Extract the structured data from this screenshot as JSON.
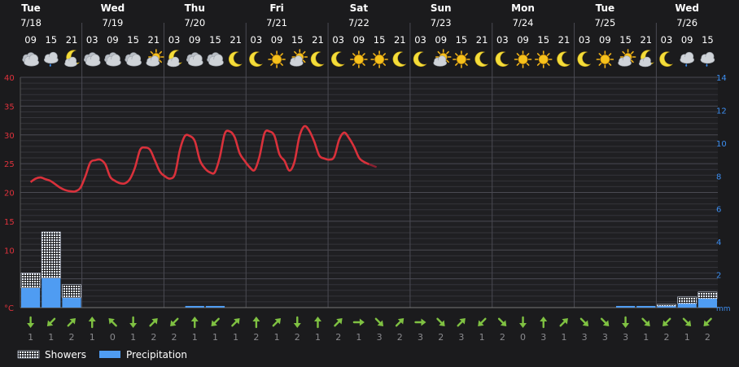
{
  "chart_data": {
    "type": "line",
    "days": [
      {
        "label": "Tue",
        "date": "7/18"
      },
      {
        "label": "Wed",
        "date": "7/19"
      },
      {
        "label": "Thu",
        "date": "7/20"
      },
      {
        "label": "Fri",
        "date": "7/21"
      },
      {
        "label": "Sat",
        "date": "7/22"
      },
      {
        "label": "Sun",
        "date": "7/23"
      },
      {
        "label": "Mon",
        "date": "7/24"
      },
      {
        "label": "Tue",
        "date": "7/25"
      },
      {
        "label": "Wed",
        "date": "7/26"
      }
    ],
    "hours": [
      "09",
      "15",
      "21",
      "03",
      "09",
      "15",
      "21",
      "03",
      "09",
      "15",
      "21",
      "03",
      "09",
      "15",
      "21",
      "03",
      "09",
      "15",
      "21",
      "03",
      "09",
      "15",
      "21",
      "03",
      "09",
      "15",
      "21",
      "03",
      "09",
      "15",
      "21",
      "03",
      "09",
      "15"
    ],
    "weather_icons": [
      "cloudy-icon",
      "rain-cloud-icon",
      "partly-cloudy-night-icon",
      "cloudy-icon",
      "cloudy-icon",
      "cloudy-icon",
      "partly-cloudy-day-icon",
      "partly-cloudy-night-icon",
      "cloudy-icon",
      "cloudy-icon",
      "moon-icon",
      "moon-icon",
      "sun-icon",
      "partly-cloudy-day-icon",
      "moon-icon",
      "moon-icon",
      "sun-icon",
      "sun-icon",
      "moon-icon",
      "moon-icon",
      "partly-cloudy-day-icon",
      "sun-icon",
      "moon-icon",
      "moon-icon",
      "sun-icon",
      "sun-icon",
      "moon-icon",
      "moon-icon",
      "sun-icon",
      "partly-cloudy-day-icon",
      "partly-cloudy-night-icon",
      "moon-icon",
      "rain-cloud-icon",
      "rain-cloud-icon"
    ],
    "temperature_series": {
      "name": "Temperature",
      "color": "#d9313b",
      "unit": "°C",
      "x": [
        0,
        0.5,
        1,
        1.5,
        2,
        2.5,
        3,
        3.5,
        4,
        4.5,
        5,
        5.5,
        6,
        6.5,
        7,
        7.5,
        8,
        8.5,
        9,
        9.5,
        10,
        10.5,
        11,
        11.5,
        12,
        12.5,
        13,
        13.5,
        14,
        14.5,
        15,
        15.5,
        16,
        16.5,
        17,
        17.5,
        18,
        18.5,
        19,
        19.5,
        20,
        20.5,
        21,
        21.5,
        22,
        22.5,
        23,
        23.5,
        24,
        24.5,
        25,
        25.5,
        26,
        26.5,
        27,
        27.5,
        28,
        28.5,
        29,
        29.5,
        30,
        30.5,
        31,
        31.5,
        32,
        32.5,
        33,
        33.5,
        34
      ],
      "values": [
        21.8,
        22.4,
        22.6,
        22.3,
        22.0,
        21.4,
        20.8,
        20.4,
        20.2,
        20.2,
        20.8,
        22.8,
        25.2,
        25.6,
        25.7,
        24.9,
        22.7,
        22.0,
        21.6,
        21.6,
        22.4,
        24.4,
        27.4,
        27.8,
        27.4,
        25.5,
        23.6,
        22.8,
        22.4,
        23.2,
        27.4,
        29.8,
        29.8,
        28.9,
        25.6,
        24.2,
        23.5,
        23.5,
        26.1,
        30.2,
        30.6,
        29.6,
        26.8,
        25.5,
        24.4,
        23.9,
        26.3,
        30.3,
        30.6,
        29.8,
        26.6,
        25.5,
        23.8,
        25.3,
        29.7,
        31.5,
        30.7,
        28.8,
        26.4,
        25.9,
        25.7,
        26.2,
        29.2,
        30.4,
        29.4,
        27.9,
        26.0,
        25.3,
        24.9
      ]
    },
    "forecast_tail": {
      "x": [
        34,
        34.5
      ],
      "values": [
        24.9,
        24.4
      ],
      "color": "#8a2030"
    },
    "showers": {
      "name": "Showers",
      "values": [
        0.9,
        2.8,
        0.8,
        0,
        0,
        0,
        0,
        0,
        0,
        0,
        0,
        0,
        0,
        0,
        0,
        0,
        0,
        0,
        0,
        0,
        0,
        0,
        0,
        0,
        0,
        0,
        0,
        0,
        0,
        0,
        0,
        0.1,
        0.4,
        0.4
      ]
    },
    "precipitation": {
      "name": "Precipitation",
      "values": [
        1.2,
        1.8,
        0.6,
        0,
        0,
        0,
        0,
        0,
        0.1,
        0.1,
        0,
        0,
        0,
        0,
        0,
        0,
        0,
        0,
        0,
        0,
        0,
        0,
        0,
        0,
        0,
        0,
        0,
        0,
        0,
        0.1,
        0.1,
        0.1,
        0.25,
        0.55
      ]
    },
    "wind": {
      "directions": [
        "S",
        "SW",
        "NE",
        "N",
        "NW",
        "S",
        "NE",
        "SW",
        "N",
        "SW",
        "NE",
        "N",
        "NE",
        "S",
        "N",
        "NE",
        "E",
        "SE",
        "NE",
        "E",
        "SE",
        "NE",
        "SW",
        "SE",
        "S",
        "N",
        "NE",
        "SE",
        "SE",
        "S",
        "SE",
        "SW",
        "SE",
        "SW"
      ],
      "speeds": [
        1,
        1,
        2,
        1,
        0,
        1,
        2,
        2,
        1,
        1,
        1,
        2,
        1,
        2,
        1,
        2,
        1,
        3,
        2,
        3,
        2,
        3,
        1,
        2,
        0,
        3,
        1,
        3,
        3,
        3,
        1,
        2,
        1,
        2
      ]
    },
    "y_left": {
      "min": 0,
      "max": 40,
      "ticks": [
        40,
        35,
        30,
        25,
        20,
        15,
        10
      ],
      "unit": "°C",
      "color": "#e0323c"
    },
    "y_right": {
      "min": 0,
      "max": 14,
      "ticks": [
        14,
        12,
        10,
        8,
        6,
        4,
        2
      ],
      "unit": "mm",
      "color": "#3d8ef0"
    },
    "grid": true,
    "legend": [
      {
        "name": "Showers",
        "pattern": "hatch"
      },
      {
        "name": "Precipitation",
        "color": "#4f9cf2"
      }
    ],
    "legend_position": "bottom-left"
  }
}
